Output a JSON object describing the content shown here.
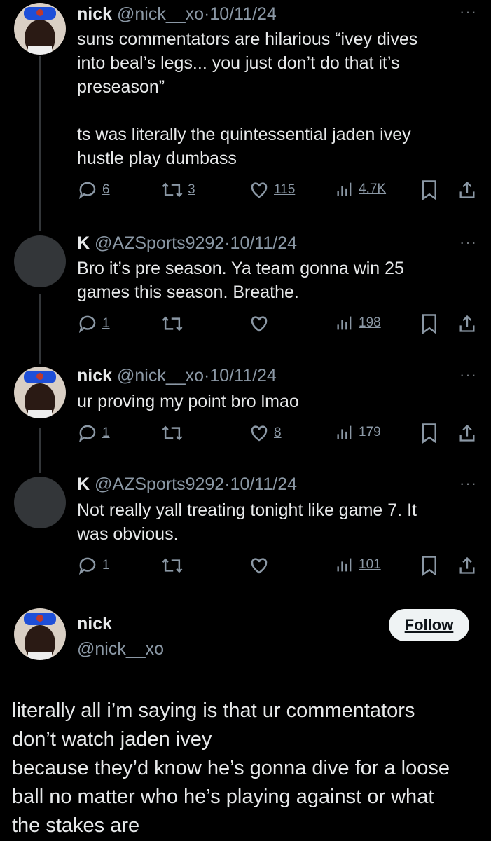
{
  "thread": [
    {
      "name": "nick",
      "handle": "@nick__xo",
      "date": "·10/11/24",
      "more": "···",
      "text": [
        "suns commentators are hilarious “ivey dives",
        "into beal’s legs... you just don’t do that it’s",
        "preseason”",
        "",
        "ts was literally the quintessential jaden ivey",
        "hustle play dumbass"
      ],
      "replies": "6",
      "reposts": "3",
      "likes": "115",
      "views": "4.7K"
    },
    {
      "name": "K",
      "handle": "@AZSports9292",
      "date": "·10/11/24",
      "more": "···",
      "text": [
        "Bro it’s pre season. Ya team gonna win 25",
        "games this season. Breathe."
      ],
      "replies": "1",
      "reposts": "",
      "likes": "",
      "views": "198"
    },
    {
      "name": "nick",
      "handle": "@nick__xo",
      "date": "·10/11/24",
      "more": "···",
      "text": [
        "ur proving my point bro lmao"
      ],
      "replies": "1",
      "reposts": "",
      "likes": "8",
      "views": "179"
    },
    {
      "name": "K",
      "handle": "@AZSports9292",
      "date": "·10/11/24",
      "more": "···",
      "text": [
        "Not really yall treating tonight like game 7. It",
        "was obvious."
      ],
      "replies": "1",
      "reposts": "",
      "likes": "",
      "views": "101"
    }
  ],
  "main": {
    "name": "nick",
    "handle": "@nick__xo",
    "follow_label": "Follow",
    "text": [
      "literally all i’m saying is that ur commentators",
      "don’t watch jaden ivey",
      "because they’d know he’s gonna dive for a loose",
      "ball no matter who he’s playing against or what",
      "the stakes are"
    ]
  },
  "colors": {
    "background": "#000000",
    "text": "#e7e9ea",
    "muted": "#8b98a5",
    "avatar_grey": "#333639"
  }
}
